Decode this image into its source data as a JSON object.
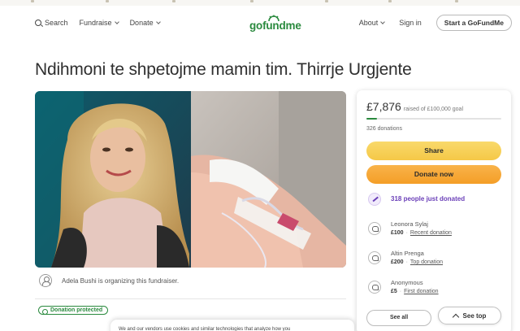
{
  "nav": {
    "search_label": "Search",
    "fundraise_label": "Fundraise",
    "donate_label": "Donate",
    "about_label": "About",
    "signin_label": "Sign in",
    "start_label": "Start a GoFundMe"
  },
  "logo": {
    "text": "gofundme"
  },
  "campaign": {
    "title": "Ndihmoni te shpetojme mamin tim. Thirrje Urgjente",
    "organizer_text": "Adela Bushi is organizing this fundraiser.",
    "protected_label": "Donation protected"
  },
  "donation_card": {
    "raised": "£7,876",
    "goal_text": "raised of £100,000 goal",
    "progress_fraction": 0.079,
    "donations_count": "326 donations",
    "share_label": "Share",
    "donate_label": "Donate now",
    "recent_count_text": "318 people just donated",
    "donors": [
      {
        "name": "Leonora Sylaj",
        "amount": "£100",
        "tag": "Recent donation"
      },
      {
        "name": "Altin Prenga",
        "amount": "£200",
        "tag": "Top donation"
      },
      {
        "name": "Anonymous",
        "amount": "£5",
        "tag": "First donation"
      }
    ],
    "partial_button": "See all"
  },
  "see_top_label": "See top",
  "cookie_text": "We and our vendors use cookies and similar technologies that analyze how you"
}
